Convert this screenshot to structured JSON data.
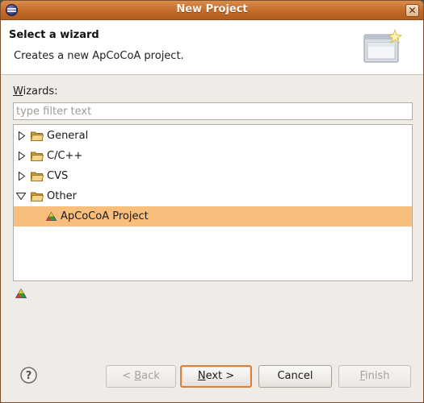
{
  "window": {
    "title": "New Project"
  },
  "header": {
    "title": "Select a wizard",
    "description": "Creates a new ApCoCoA project."
  },
  "wizards_label": {
    "mnemonic": "W",
    "rest": "izards:"
  },
  "filter": {
    "value": "",
    "placeholder": "type filter text"
  },
  "tree": {
    "items": [
      {
        "label": "General",
        "type": "folder",
        "expanded": false
      },
      {
        "label": "C/C++",
        "type": "folder",
        "expanded": false
      },
      {
        "label": "CVS",
        "type": "folder",
        "expanded": false
      },
      {
        "label": "Other",
        "type": "folder",
        "expanded": true
      },
      {
        "label": "ApCoCoA Project",
        "type": "project",
        "selected": true
      }
    ]
  },
  "buttons": {
    "back": {
      "prefix": "< ",
      "mnemonic": "B",
      "rest": "ack",
      "enabled": false
    },
    "next": {
      "mnemonic": "N",
      "rest": "ext >",
      "enabled": true,
      "default": true
    },
    "cancel": {
      "label": "Cancel",
      "enabled": true
    },
    "finish": {
      "mnemonic": "F",
      "rest": "inish",
      "enabled": false
    }
  },
  "colors": {
    "titlebar": "#c26a29",
    "selection": "#f7be7c",
    "default_button_border": "#d9813d"
  },
  "icons": {
    "window": "eclipse-icon",
    "banner": "new-wizard-icon",
    "folder": "folder-icon",
    "project": "apcocoa-project-icon",
    "help": "help-icon"
  }
}
